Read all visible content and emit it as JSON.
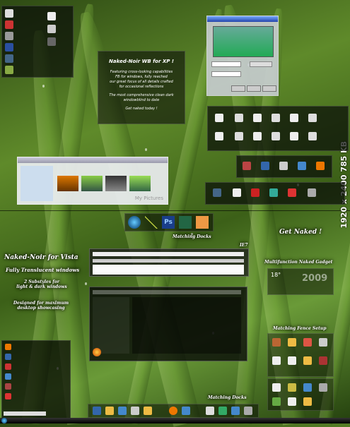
{
  "side_label": "1920 x 2400 785 KB",
  "xp_banner": {
    "title": "Naked-Noir WB for XP !",
    "lines": [
      "Featuring cross-looking capabilities",
      "FB for windows, fully reached",
      "our great focus of all details crafted",
      "for occasional reflections",
      "",
      "The most comprehensive clean dark",
      "windowblind to date",
      "",
      "Get naked today !"
    ]
  },
  "get_naked": "Get Naked !",
  "matching_docks_top": "Matching Docks",
  "matching_docks_bottom": "Matching Docks",
  "ie7_label": "IE7",
  "vista_title": "Naked-Noir for Vista",
  "vista_sub": "Fully Translucent windows",
  "vista_styles": [
    "2 Substyles for",
    "light & dark windows"
  ],
  "vista_design": [
    "Designed for maximum",
    "desktop showcasing"
  ],
  "gadget_label": "Multifunction Naked Gadget",
  "gadget_temp": "18°",
  "gadget_year": "2009",
  "fence_label": "Matching Fence Setup",
  "dock_items": [
    "windows-orb-icon",
    "tools-icon",
    "photoshop-icon",
    "leaf-icon",
    "app-icon"
  ],
  "my_pictures": "My Pictures",
  "colors": {
    "accent": "#e0f0ff",
    "grass": "#5f8a2a"
  }
}
